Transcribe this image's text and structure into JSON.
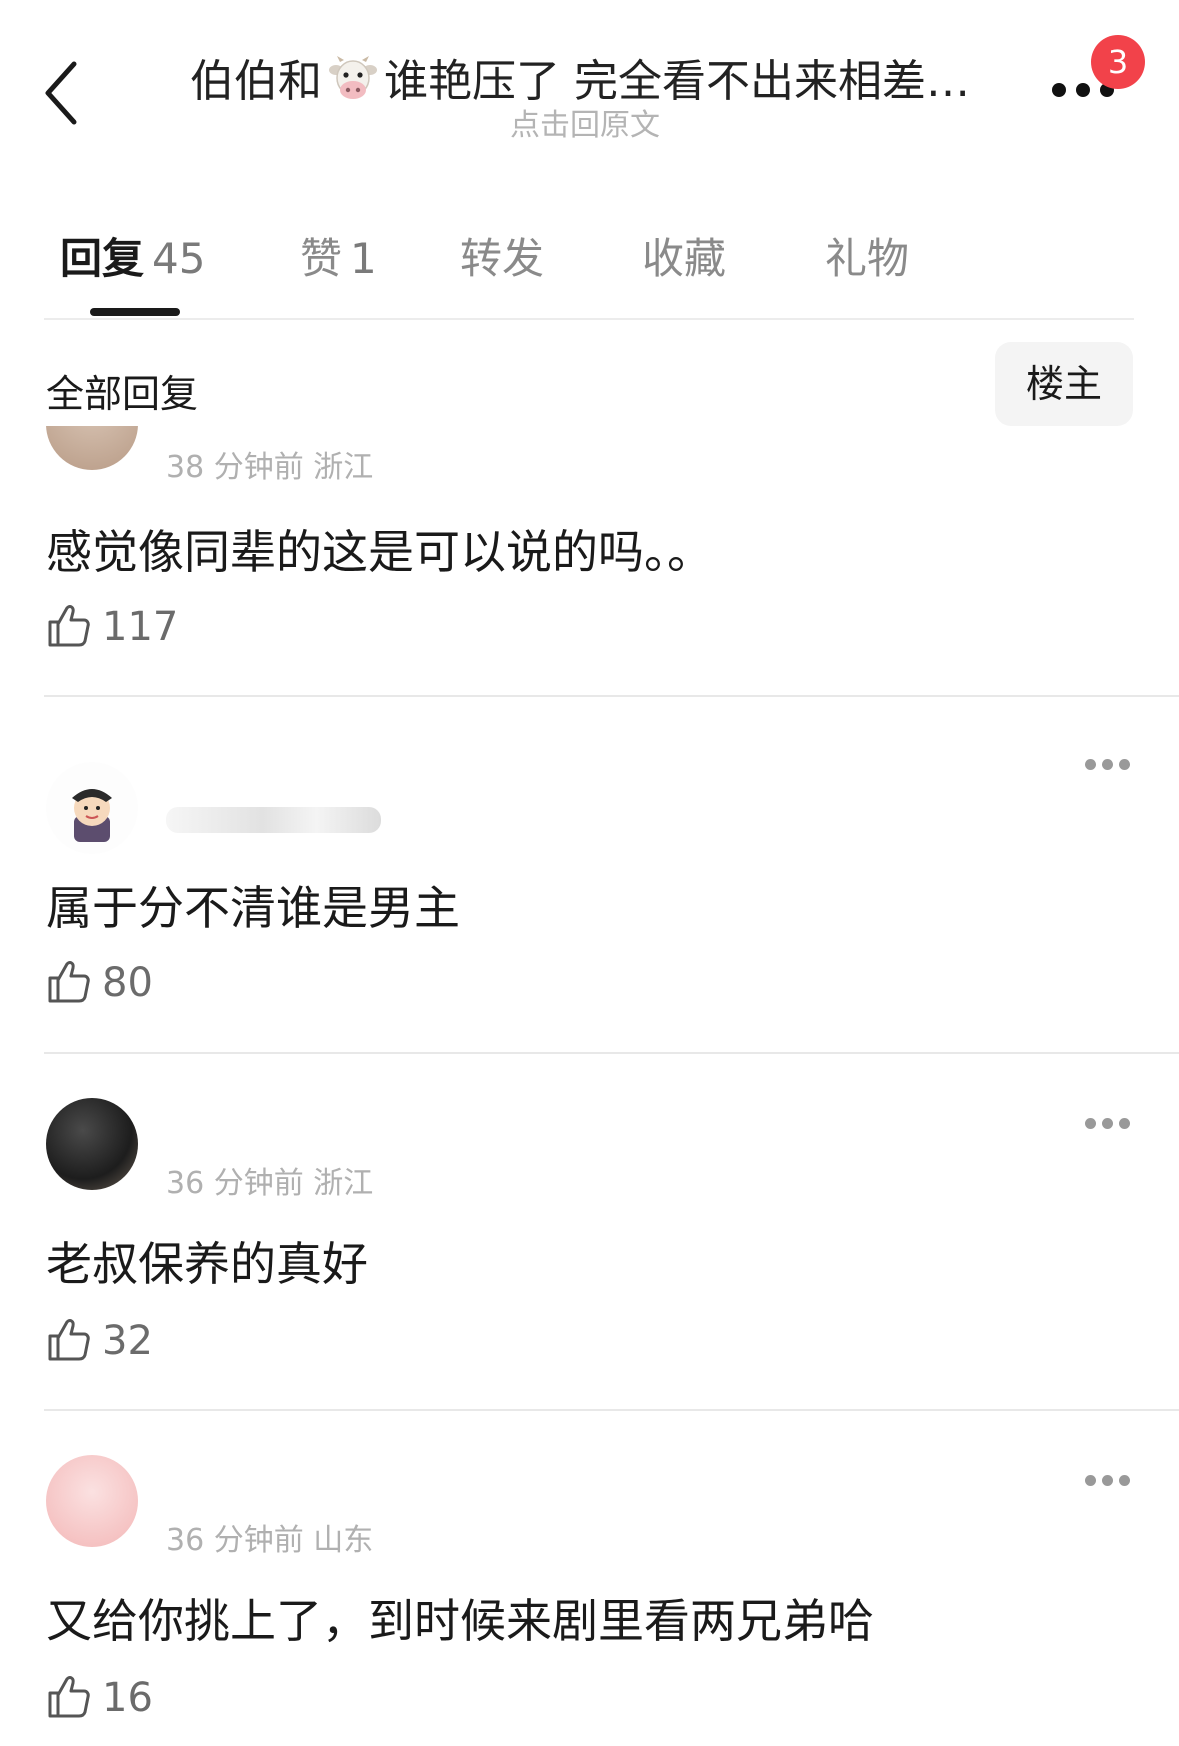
{
  "header": {
    "title_prefix": "伯伯和",
    "title_suffix": "谁艳压了 完全看不出来相差…",
    "subtitle": "点击回原文",
    "badge_count": "3"
  },
  "tabs": [
    {
      "label": "回复",
      "count": "45",
      "active": true
    },
    {
      "label": "赞",
      "count": "1"
    },
    {
      "label": "转发",
      "count": ""
    },
    {
      "label": "收藏",
      "count": ""
    },
    {
      "label": "礼物",
      "count": ""
    }
  ],
  "filter": {
    "all_label": "全部回复",
    "op_label": "楼主"
  },
  "comments": [
    {
      "meta": "38 分钟前 浙江",
      "text": "感觉像同辈的这是可以说的吗。。",
      "likes": "117"
    },
    {
      "meta": "",
      "text": "属于分不清谁是男主",
      "likes": "80"
    },
    {
      "meta": "36 分钟前 浙江",
      "text": "老叔保养的真好",
      "likes": "32"
    },
    {
      "meta": "36 分钟前 山东",
      "text": "又给你挑上了，到时候来剧里看两兄弟哈",
      "likes": "16"
    }
  ],
  "colors": {
    "badge": "#f2424a",
    "text": "#1a1a1a",
    "muted": "#b0b0b0"
  },
  "icons": {
    "back": "chevron-left-icon",
    "more": "more-dots-icon",
    "like": "thumbs-up-icon"
  }
}
